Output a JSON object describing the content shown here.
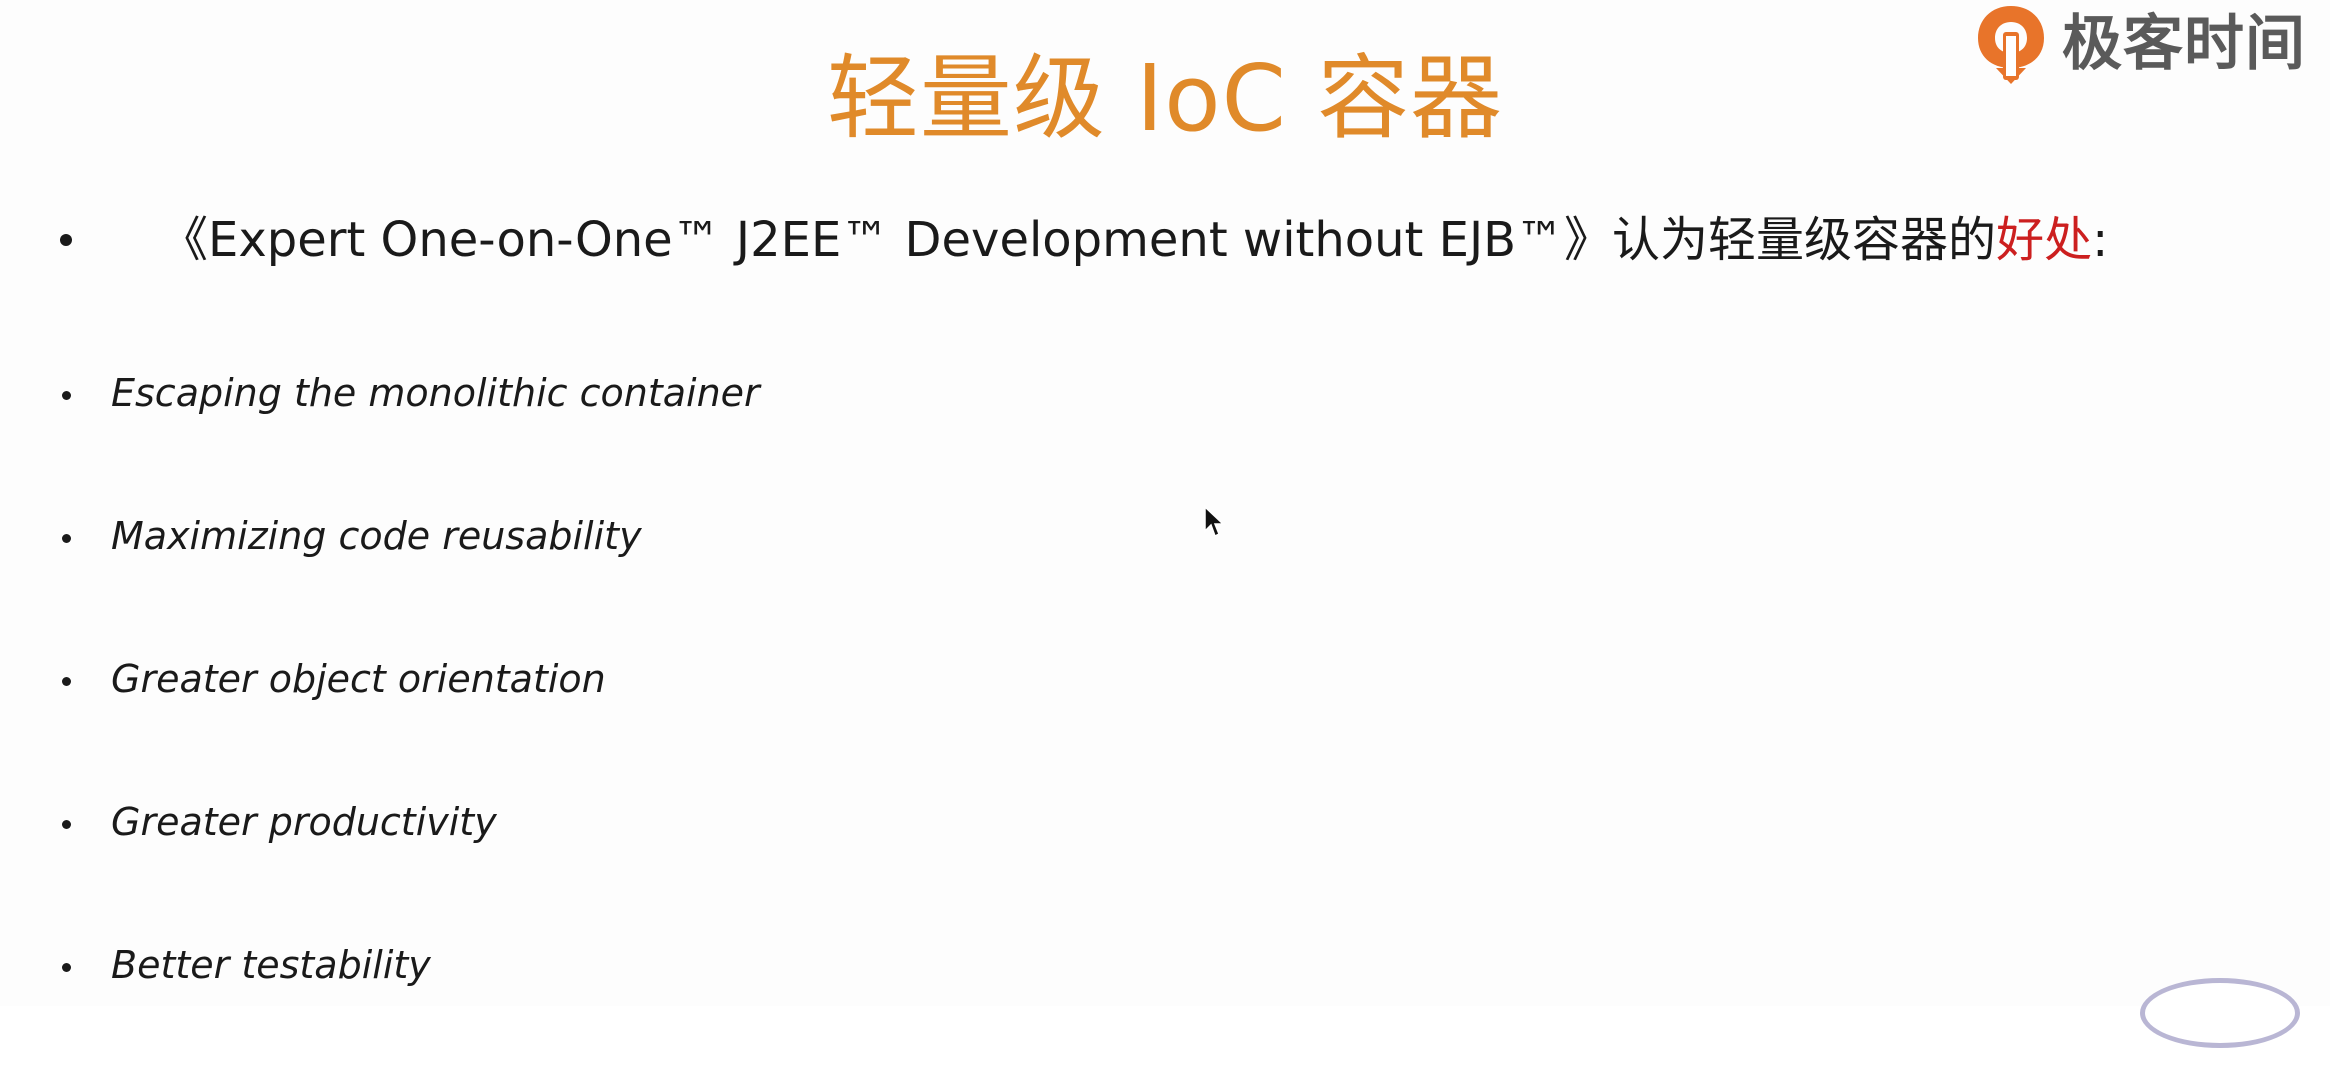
{
  "logo": {
    "text": "极客时间",
    "icon": "geektime-logo-icon",
    "mark_color": "#e8742a"
  },
  "title": "轻量级 IoC 容器",
  "intro": {
    "text_main": "《Expert One-on-One™ J2EE™ Development without EJB™》认为轻量级容器的",
    "text_highlight": "好处",
    "text_end": ":"
  },
  "benefits": [
    "Escaping the monolithic container",
    "Maximizing code reusability",
    "Greater object orientation",
    "Greater productivity",
    "Better testability"
  ],
  "colors": {
    "title": "#e08a2a",
    "highlight": "#cc1f1f",
    "text": "#1a1a1a",
    "logo_text": "#5a5a5a"
  }
}
